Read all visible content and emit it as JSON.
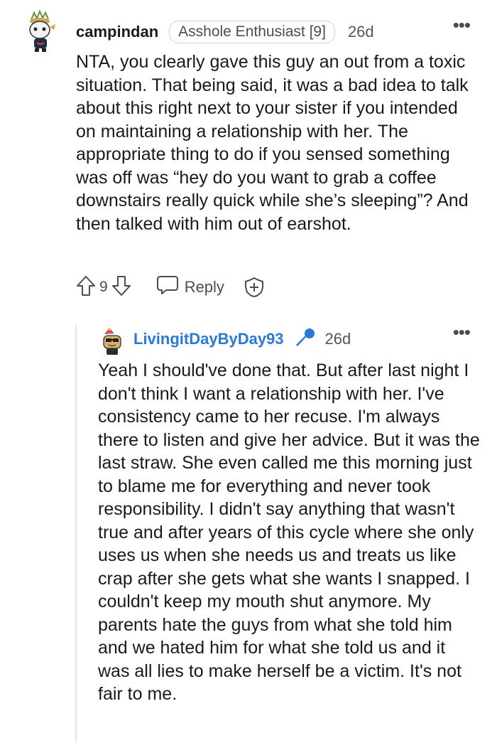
{
  "top_comment": {
    "username": "campindan",
    "flair": "Asshole Enthusiast [9]",
    "age": "26d",
    "more": "•••",
    "body": "NTA, you clearly gave this guy an out from a toxic situation. That being said, it was a bad idea to talk about this right next to your sister if you intended on maintaining a relationship with her. The appropriate thing to do if you sensed something was off was “hey do you want to grab a coffee downstairs really quick while she’s sleeping”? And then talked with him out of earshot.",
    "vote_count": "9",
    "reply_label": "Reply",
    "icons": [
      "avatar",
      "upvote-icon",
      "downvote-icon",
      "reply-icon",
      "award-icon",
      "more-options-icon"
    ]
  },
  "reply_comment": {
    "username": "LivingitDayByDay93",
    "age": "26d",
    "more": "•••",
    "body": "Yeah I should've done that. But after last night I don't think I want a relationship with her. I've consistency came to her recuse. I'm always there to listen and give her advice. But it was the last straw. She even called me this morning just to blame me for everything and never took responsibility. I didn't say anything that wasn't true and after years of this cycle where she only uses us when she needs us and treats us like crap after she gets what she wants I snapped. I couldn't keep my mouth shut anymore. My parents hate the guys from what she told him and we hated him for what she told us and it was all lies to make herself be a victim. It's not fair to me.",
    "icons": [
      "avatar",
      "microphone-icon",
      "more-options-icon"
    ]
  },
  "colors": {
    "text": "#1a1a1b",
    "muted": "#4a4d50",
    "reply_username": "#2a79d6",
    "mic": "#2a79d6",
    "thread_line": "#e4e6e8"
  }
}
